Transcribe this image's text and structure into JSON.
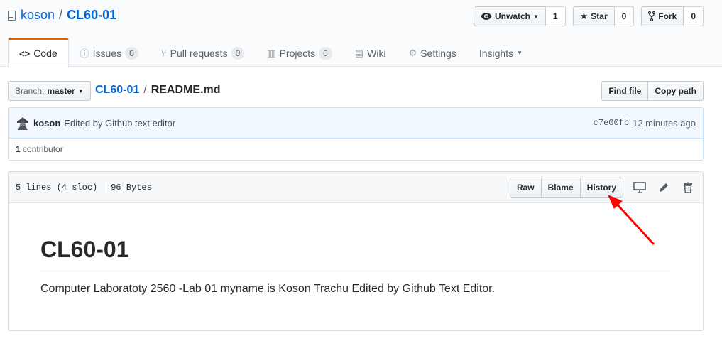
{
  "repo": {
    "owner": "koson",
    "separator": "/",
    "name": "CL60-01"
  },
  "actions": {
    "watch_label": "Unwatch",
    "watch_count": "1",
    "star_label": "Star",
    "star_count": "0",
    "fork_label": "Fork",
    "fork_count": "0"
  },
  "nav": [
    {
      "label": "Code",
      "icon": "code-icon",
      "counter": ""
    },
    {
      "label": "Issues",
      "icon": "issue-icon",
      "counter": "0"
    },
    {
      "label": "Pull requests",
      "icon": "pull-request-icon",
      "counter": "0"
    },
    {
      "label": "Projects",
      "icon": "project-icon",
      "counter": "0"
    },
    {
      "label": "Wiki",
      "icon": "book-icon",
      "counter": ""
    },
    {
      "label": "Settings",
      "icon": "gear-icon",
      "counter": ""
    },
    {
      "label": "Insights",
      "icon": "",
      "counter": ""
    }
  ],
  "branch": {
    "prefix": "Branch:",
    "name": "master"
  },
  "breadcrumb": {
    "repo": "CL60-01",
    "separator": "/",
    "file": "README.md"
  },
  "file_nav": {
    "find_file": "Find file",
    "copy_path": "Copy path"
  },
  "commit": {
    "author": "koson",
    "message": "Edited by Github text editor",
    "sha": "c7e00fb",
    "time": "12 minutes ago",
    "contributors_count": "1",
    "contributors_label": "contributor"
  },
  "file": {
    "lines": "5 lines (4 sloc)",
    "size": "96 Bytes",
    "raw_label": "Raw",
    "blame_label": "Blame",
    "history_label": "History"
  },
  "readme": {
    "heading": "CL60-01",
    "body": "Computer Laboratoty 2560 -Lab 01 myname is Koson Trachu Edited by Github Text Editor."
  },
  "colors": {
    "link": "#0366d6",
    "selected_tab": "#e36209",
    "annotation_arrow": "#ff0000"
  }
}
